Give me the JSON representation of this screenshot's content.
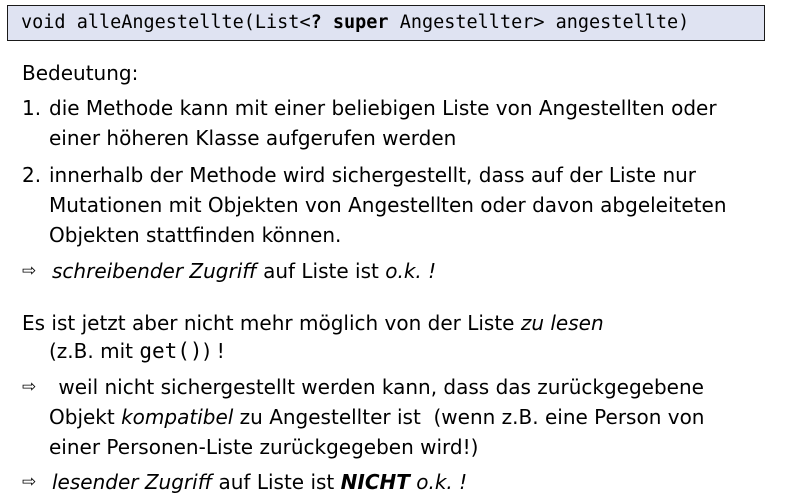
{
  "code": {
    "part1": "void alleAngestellte(List<",
    "bold": "? super",
    "part2": " Angestellter> angestellte)"
  },
  "heading": "Bedeutung:",
  "item1": {
    "num": "1.",
    "line1": "die Methode kann mit einer beliebigen Liste von Angestellten oder",
    "line2": "einer höheren Klasse aufgerufen werden"
  },
  "item2": {
    "num": "2.",
    "line1": "innerhalb der Methode wird sichergestellt, dass auf der Liste nur",
    "line2": "Mutationen mit Objekten von Angestellten oder davon abgeleiteten",
    "line3": "Objekten stattfinden können."
  },
  "arrow_icon": "⇨",
  "conclusion1": {
    "italic": "schreibender Zugriff",
    "mid": " auf Liste ist ",
    "tail": "o.k. !"
  },
  "para2": {
    "line1_pre": "Es ist jetzt aber nicht mehr möglich von der Liste ",
    "line1_italic": "zu lesen",
    "line2_pre": "(z.B. mit ",
    "line2_code": "get()",
    "line2_post": ") !"
  },
  "reason": {
    "line1": " weil nicht sichergestellt werden kann, dass das zurückgegebene",
    "line2_pre": "Objekt ",
    "line2_italic": "kompatibel",
    "line2_post": " zu Angestellter ist  (wenn z.B. eine Person von",
    "line3": "einer Personen-Liste zurückgegeben wird!)"
  },
  "conclusion2": {
    "italic": "lesender Zugriff",
    "mid": " auf Liste ist ",
    "strong": "NICHT",
    "tail": " o.k. !"
  }
}
